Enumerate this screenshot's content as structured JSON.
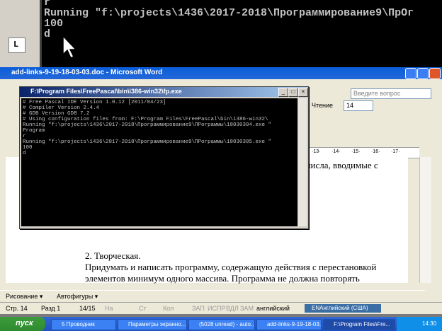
{
  "background_console": {
    "lines": [
      "r",
      "Running \"f:\\projects\\1436\\2017-2018\\Программирование9\\ПрОг",
      "100",
      "d"
    ]
  },
  "word": {
    "title": "add-links-9-19-18-03-03.doc - Microsoft Word",
    "ask_placeholder": "Введите вопрос",
    "reading_button": "Чтение",
    "font_size": "14",
    "ruler_numbers": [
      "·13·",
      "·14·",
      "·15·",
      "·16·",
      "·17·"
    ],
    "doc_lines": [
      "числа, вводимые с",
      "2. Творческая.",
      "Придумать и написать программу, содержащую действия с перестановкой",
      "элементов минимум одного массива. Программа не должна повторять"
    ],
    "drawbar": {
      "draw": "Рисование ▾",
      "autoshapes": "Автофигуры ▾"
    },
    "status": {
      "page": "Стр. 14",
      "section": "Разд 1",
      "pages": "14/15",
      "at": "На",
      "ln": "Ст",
      "col": "Кол",
      "rec": "ЗАП",
      "trk": "ИСПР",
      "ext": "ВДЛ",
      "ovr": "ЗАМ",
      "lang": "английский"
    },
    "language_bar": "ENАнглийский (США)"
  },
  "console": {
    "title": "F:\\Program Files\\FreePascal\\bin\\i386-win32\\fp.exe",
    "lines": [
      "# Free Pascal IDE Version 1.0.12 [2011/04/23]",
      "# Compiler Version 2.4.4",
      "# GDB Version GDB 7.2",
      "# Using configuration files from: F:\\Program Files\\FreePascal\\bin\\i386-win32\\",
      "Running \"f:\\projects\\1436\\2017-2018\\Программирование9\\ПРограммы\\18030304.exe \"",
      "Program",
      "r",
      "Running \"f:\\projects\\1436\\2017-2018\\Программирование9\\ПРограммы\\18030305.exe \"",
      "100",
      "d"
    ]
  },
  "taskbar": {
    "start": "пуск",
    "tasks": [
      "5 Проводник",
      "Параметры экранно...",
      "(5028 unread) - auto...",
      "add-links-9-19-18-03...",
      "F:\\Program Files\\Fre..."
    ],
    "clock": "14:30"
  }
}
